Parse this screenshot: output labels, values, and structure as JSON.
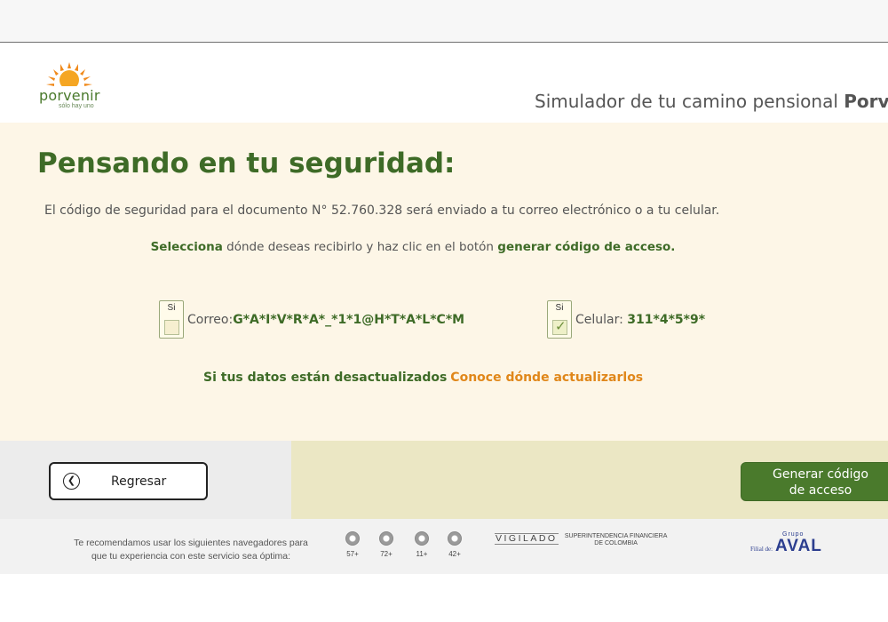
{
  "brand": {
    "name": "porvenir",
    "tagline": "sólo hay uno"
  },
  "header": {
    "title_prefix": "Simulador de tu camino pensional",
    "title_brand": "Porve"
  },
  "main": {
    "heading": "Pensando en tu seguridad:",
    "intro": "El código de seguridad para el documento N° 52.760.328 será enviado a tu correo electrónico o a tu celular.",
    "instr_pre": "Selecciona",
    "instr_mid": " dónde deseas recibirlo y haz clic en el botón ",
    "instr_post": "generar código de acceso.",
    "email_option": {
      "badge": "Si",
      "label": "Correo:",
      "value": "G*A*I*V*R*A*_*1*1@H*T*A*L*C*M",
      "checked": false
    },
    "phone_option": {
      "badge": "Si",
      "label": "Celular: ",
      "value": "311*4*5*9*",
      "checked": true
    },
    "outdated_text": "Si tus datos están desactualizados",
    "outdated_link": "Conoce dónde actualizarlos"
  },
  "actions": {
    "back_label": "Regresar",
    "generate_line1": "Generar código",
    "generate_line2": "de acceso"
  },
  "footer": {
    "recommend_line1": "Te recomendamos usar los siguientes navegadores para",
    "recommend_line2": "que tu experiencia con este servicio sea óptima:",
    "browsers": [
      {
        "icon": "chrome-icon",
        "version": "57+"
      },
      {
        "icon": "firefox-icon",
        "version": "72+"
      },
      {
        "icon": "ie-icon",
        "version": "11+"
      },
      {
        "icon": "edge-icon",
        "version": "42+"
      }
    ],
    "vigilado": "VIGILADO",
    "superfinanciera_line1": "SUPERINTENDENCIA FINANCIERA",
    "superfinanciera_line2": "DE COLOMBIA",
    "aval_grupo": "Grupo",
    "aval_filial": "Filial de:",
    "aval_name": "AVAL"
  },
  "colors": {
    "brand_green": "#3e6b27",
    "accent_orange": "#e0871a",
    "button_green": "#4a7a2c",
    "panel_cream": "#fdf6e7"
  }
}
